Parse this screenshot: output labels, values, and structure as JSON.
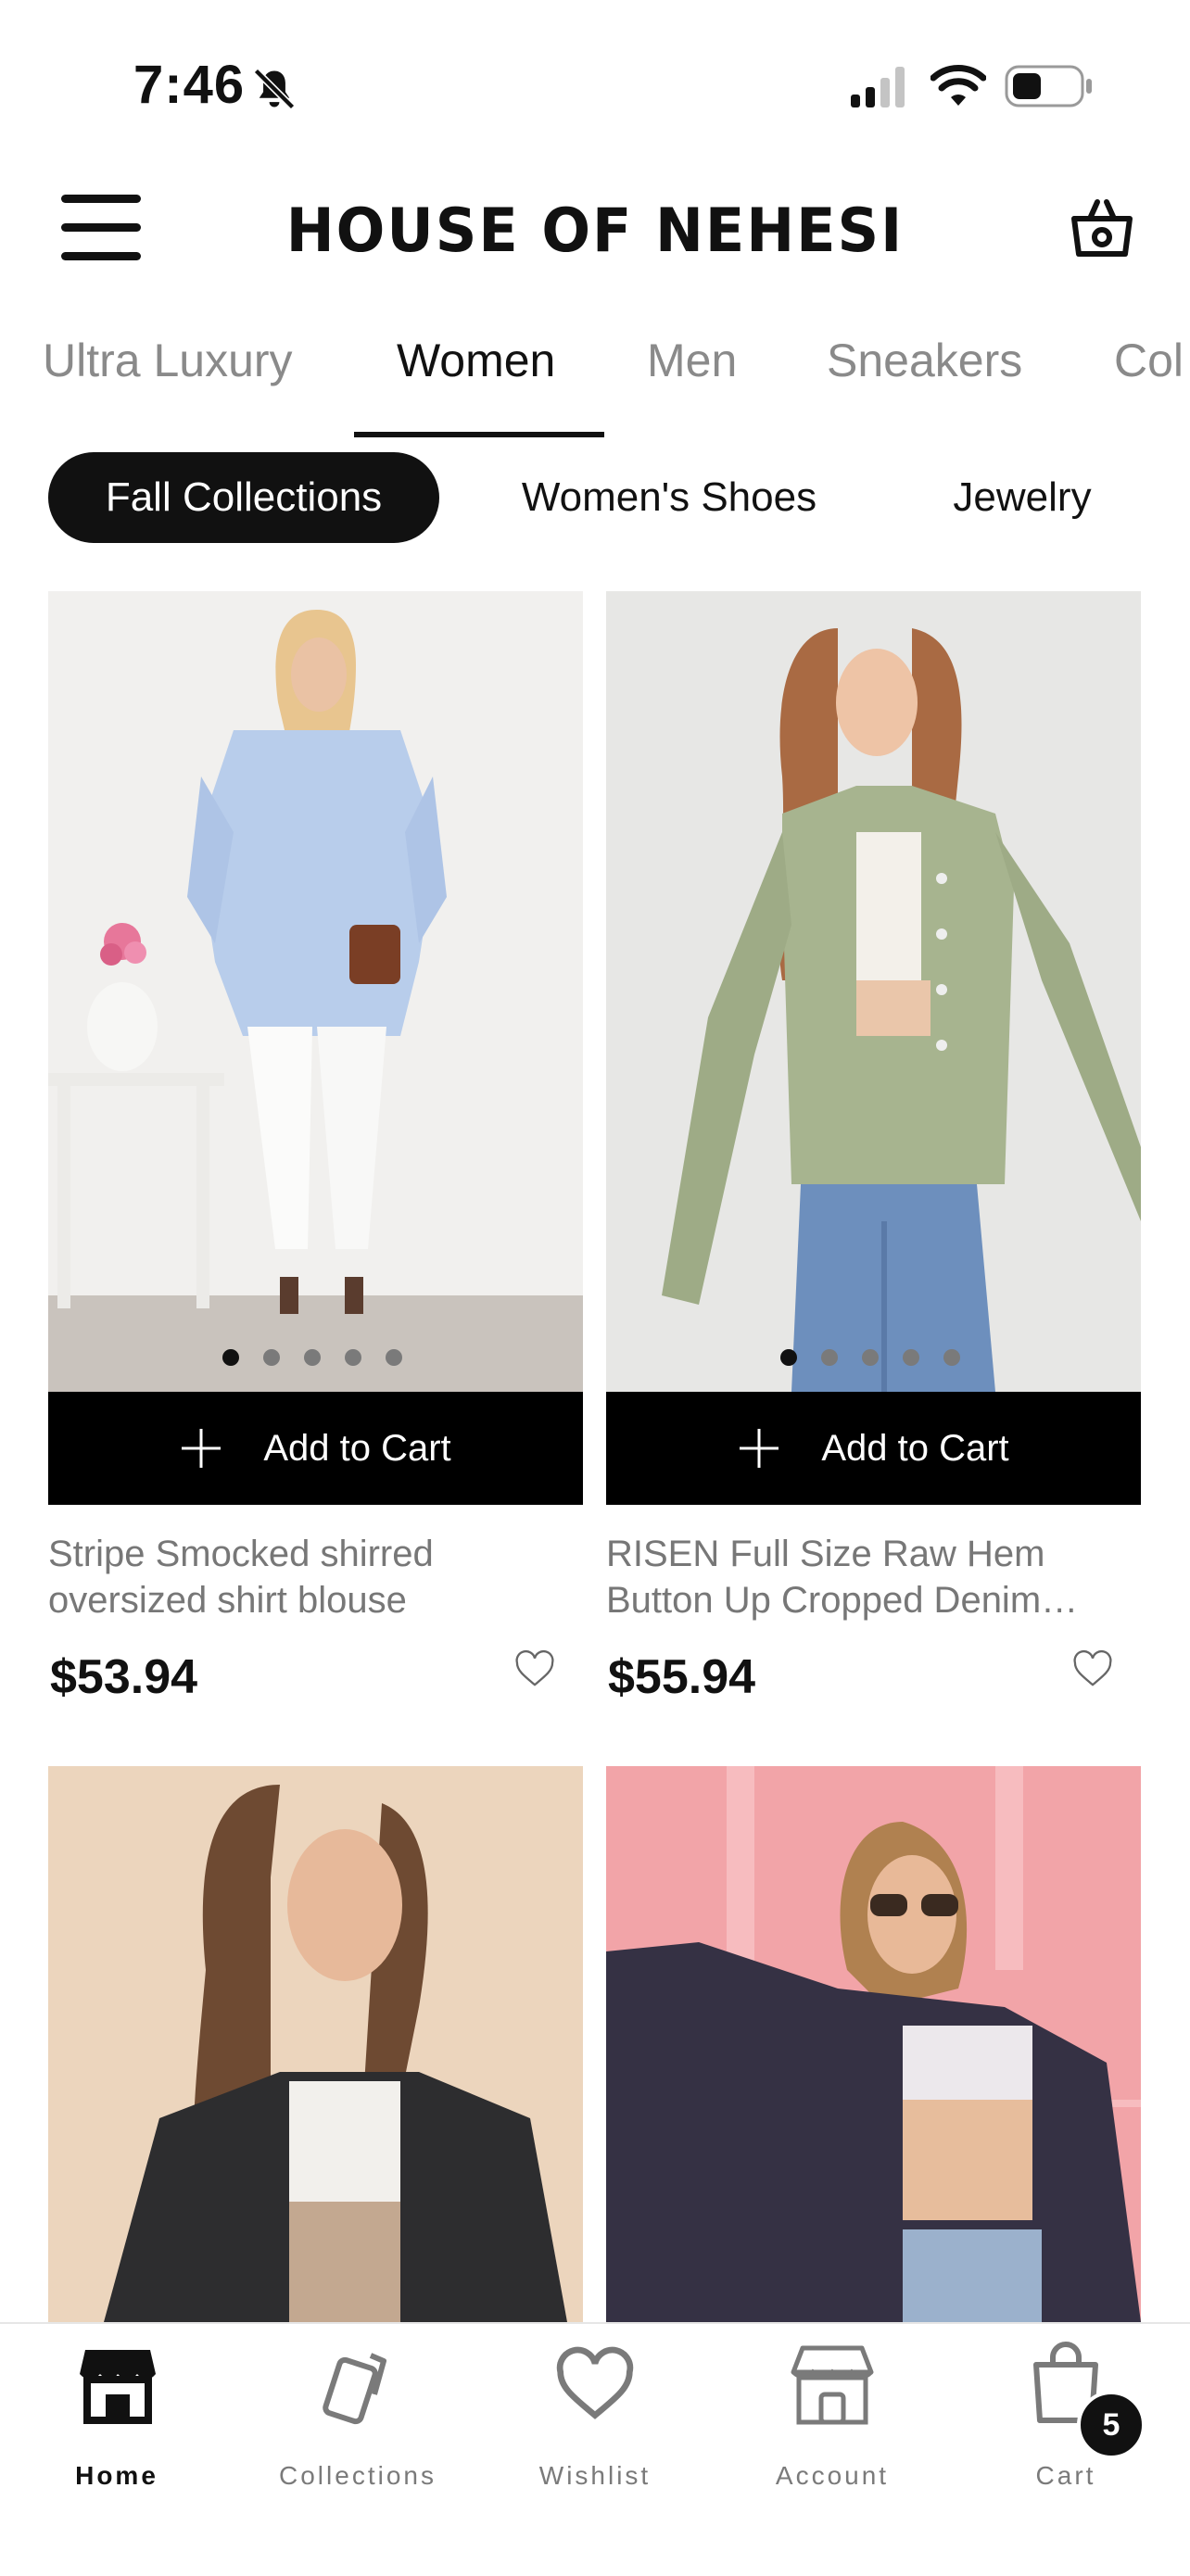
{
  "status": {
    "time": "7:46"
  },
  "header": {
    "logo": "HOUSE OF NEHESI"
  },
  "tabs": [
    {
      "label": "Ultra Luxury",
      "active": false
    },
    {
      "label": "Women",
      "active": true
    },
    {
      "label": "Men",
      "active": false
    },
    {
      "label": "Sneakers",
      "active": false
    },
    {
      "label": "Col",
      "active": false
    }
  ],
  "chips": [
    {
      "label": "Fall Collections",
      "active": true
    },
    {
      "label": "Women's Shoes",
      "active": false
    },
    {
      "label": "Jewelry",
      "active": false
    }
  ],
  "products": [
    {
      "title": "Stripe Smocked shirred oversized shirt blouse",
      "price": "$53.94",
      "add_label": "Add to Cart",
      "image_count": 5,
      "active_image": 1
    },
    {
      "title": "RISEN Full Size Raw Hem Button Up Cropped Denim…",
      "price": "$55.94",
      "add_label": "Add to Cart",
      "image_count": 5,
      "active_image": 1
    }
  ],
  "bottom_nav": [
    {
      "label": "Home",
      "active": true
    },
    {
      "label": "Collections",
      "active": false
    },
    {
      "label": "Wishlist",
      "active": false
    },
    {
      "label": "Account",
      "active": false
    },
    {
      "label": "Cart",
      "active": false
    }
  ],
  "cart_badge": "5",
  "colors": {
    "primary": "#000000",
    "muted_text": "#777777",
    "tab_inactive": "#8a8a8a"
  }
}
